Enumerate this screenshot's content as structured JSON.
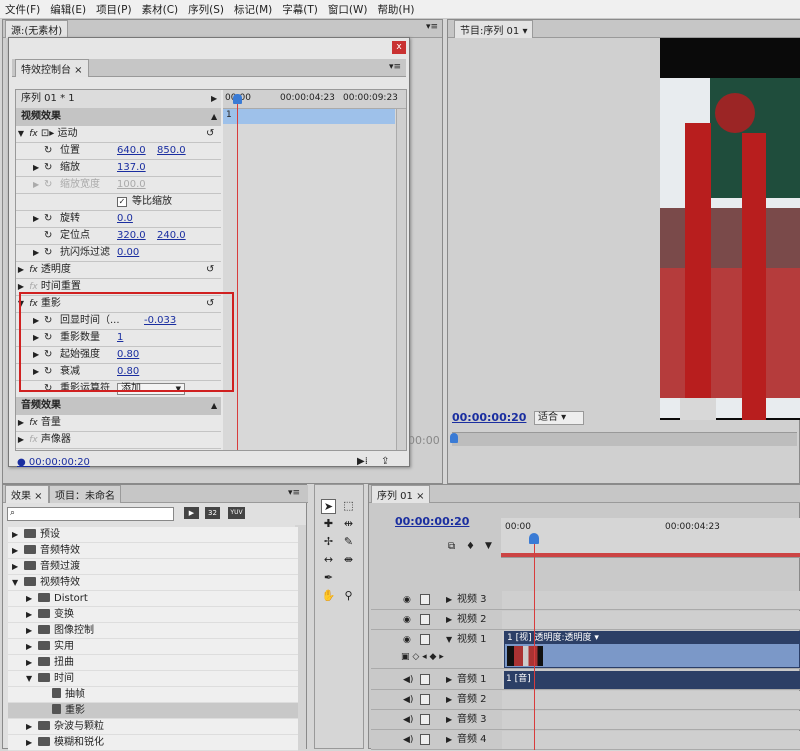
{
  "menu": [
    "文件(F)",
    "编辑(E)",
    "项目(P)",
    "素材(C)",
    "序列(S)",
    "标记(M)",
    "字幕(T)",
    "窗口(W)",
    "帮助(H)"
  ],
  "source_panel": {
    "tab": "源:(无素材)",
    "timecode": "00:00"
  },
  "program_panel": {
    "tab": "节目:序列 01",
    "timecode": "00:00:00:20",
    "zoom": "适合"
  },
  "effect_controls": {
    "tab": "特效控制台",
    "sequence": "序列 01 * 1",
    "ruler": [
      "00:00",
      "00:00:04:23",
      "00:00:09:23"
    ],
    "clip_marker": "1",
    "video_effects": "视频效果",
    "motion": "运动",
    "position": {
      "label": "位置",
      "x": "640.0",
      "y": "850.0"
    },
    "scale": {
      "label": "缩放",
      "value": "137.0"
    },
    "scale_width": {
      "label": "缩放宽度",
      "value": "100.0"
    },
    "uniform_scale": "等比缩放",
    "rotation": {
      "label": "旋转",
      "value": "0.0"
    },
    "anchor": {
      "label": "定位点",
      "x": "320.0",
      "y": "240.0"
    },
    "antiflicker": {
      "label": "抗闪烁过滤",
      "value": "0.00"
    },
    "opacity": "透明度",
    "time_remap": "时间重置",
    "echo": "重影",
    "echo_time": {
      "label": "回显时间（...",
      "value": "-0.033"
    },
    "echo_count": {
      "label": "重影数量",
      "value": "1"
    },
    "start_intensity": {
      "label": "起始强度",
      "value": "0.80"
    },
    "decay": {
      "label": "衰减",
      "value": "0.80"
    },
    "operator": {
      "label": "重影运算符",
      "value": "添加"
    },
    "audio_effects": "音频效果",
    "volume": "音量",
    "panner": "声像器",
    "footer_time": "00:00:00:20"
  },
  "effects_panel": {
    "tabs": [
      "效果",
      "项目：未命名"
    ],
    "badges": [
      "32",
      "YUV"
    ],
    "items": [
      {
        "label": "预设",
        "indent": 0
      },
      {
        "label": "音频特效",
        "indent": 0
      },
      {
        "label": "音频过渡",
        "indent": 0
      },
      {
        "label": "视频特效",
        "indent": 0
      },
      {
        "label": "Distort",
        "indent": 1
      },
      {
        "label": "变换",
        "indent": 1
      },
      {
        "label": "图像控制",
        "indent": 1
      },
      {
        "label": "实用",
        "indent": 1
      },
      {
        "label": "扭曲",
        "indent": 1
      },
      {
        "label": "时间",
        "indent": 1
      },
      {
        "label": "抽帧",
        "indent": 2
      },
      {
        "label": "重影",
        "indent": 2
      },
      {
        "label": "杂波与颗粒",
        "indent": 1
      },
      {
        "label": "模糊和锐化",
        "indent": 1
      }
    ]
  },
  "timeline": {
    "tab": "序列 01",
    "timecode": "00:00:00:20",
    "ruler": [
      "00:00",
      "00:00:04:23"
    ],
    "tracks": [
      "视频 3",
      "视频 2",
      "视频 1",
      "音频 1",
      "音频 2",
      "音频 3",
      "音频 4"
    ],
    "video_clip": "1 [视] 透明度:透明度 ▾",
    "audio_clip": "1 [音]"
  },
  "colors": {
    "accent_red": "#d02020",
    "timecode": "#1a2ea0",
    "clip_blue": "#7b98c8"
  }
}
